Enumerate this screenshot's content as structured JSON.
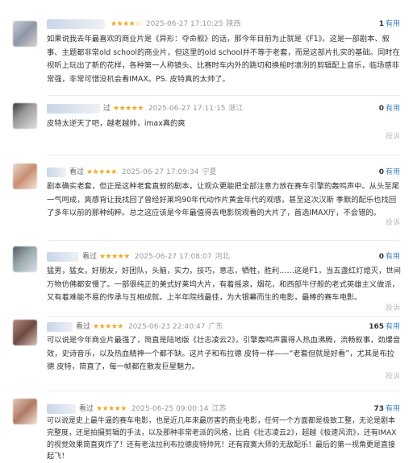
{
  "useful_label": "有用",
  "report_label": "投诉",
  "reviews": [
    {
      "status": "",
      "stars": "★★★★☆",
      "time": "2025-06-27 17:10:25",
      "location": "陕西",
      "useful_count": "1",
      "content": "如果说我去年最喜欢的商业片是《异形：夺命舰》的话，那今年目前为止就是《F1》。这是一部剧本、叙事、主题都非常old school的商业片，但这里的old school并不等于老套，而是这部片扎实的基础。同时在视听上玩出了新的花样，各种第一人称镜头、比赛时车内外的跳切和换船时凛冽的剪辑配上音乐，临场感非常强，非常可惜没机会看IMAX。PS. 皮特真的太帅了。",
      "report": ""
    },
    {
      "status": "过",
      "stars": "★★★★★",
      "time": "2025-06-27 17:11:15",
      "location": "浙江",
      "useful_count": "0",
      "content": "皮特太逆天了吧，越老越帅，imax真的爽",
      "report": "投诉"
    },
    {
      "status": "看过",
      "stars": "★★★★★",
      "time": "2025-06-27 17:09:34",
      "location": "宁夏",
      "useful_count": "0",
      "content": "剧本确实老套，但正是这种老套直叙的剧本，让观众更能把全部注意力放在赛车引擎的轰鸣声中。从头至尾一气呵成，爽感背让我找回了曾经好莱坞90年代动作片黄金年代的观感，甚至这次汉斯 季默的配乐也找回了多年以前的那种纯粹。总之这应该是今年最值得去电影院观看的大片了，首选IMAX厅，不会错的。",
      "report": "投诉"
    },
    {
      "status": "看过",
      "stars": "★★★★★",
      "time": "2025-06-27 17:08:07",
      "location": "河北",
      "useful_count": "0",
      "content": "猛男，猛女，好朋友，好团队，头脑，实力，技巧，意志，牺牲，胜利……这是F1，当五盏红灯熄灭，世间万物仿佛都安慢了。一部很纯正的美式好莱坞大片，有着摇滚，烟花，和西部牛仔般的老式英雄主义做派，又有着难能不易的传承与互相成就。上半年院线最佳，为大银幕而生的电影，最棒的赛车电影。",
      "report": "投诉"
    },
    {
      "status": "看过",
      "stars": "★★★★★",
      "time": "2025-06-23 22:40:47",
      "location": "广东",
      "useful_count": "165",
      "content": "可以说是今年商业片最强了，简直是陆地版《壮志凌云2》，引擎轰鸣声震得人热血沸腾，流畅叙事，劲爆音效，史诗音乐，以及热血精神一个都不缺。这片子和布拉德 皮特一样——“老套但就是好看”，尤其是布拉德 皮特，简直了，每一帧都在散发巨星魅力。",
      "report": "投诉"
    },
    {
      "status": "看过",
      "stars": "★★★★★",
      "time": "2025-06-25 09:00:14",
      "location": "江苏",
      "useful_count": "73",
      "content": "可以说是史上最牛逼的赛车电影，也是近几年来最厉害的商业电影，任何一个方面都是极致工整，无论是剧本完整度，还是拍摄剪辑的手法，以及那种非常老派的风格，比肩《壮志凌云2》，超越《极速风流》，还有IMAX的视觉效果简直爽炸了！还有老法拉利布拉德皮特帅死！还有寂寞大师的无敌配乐！最后的第一视角更是直接起飞！",
      "report": ""
    }
  ]
}
